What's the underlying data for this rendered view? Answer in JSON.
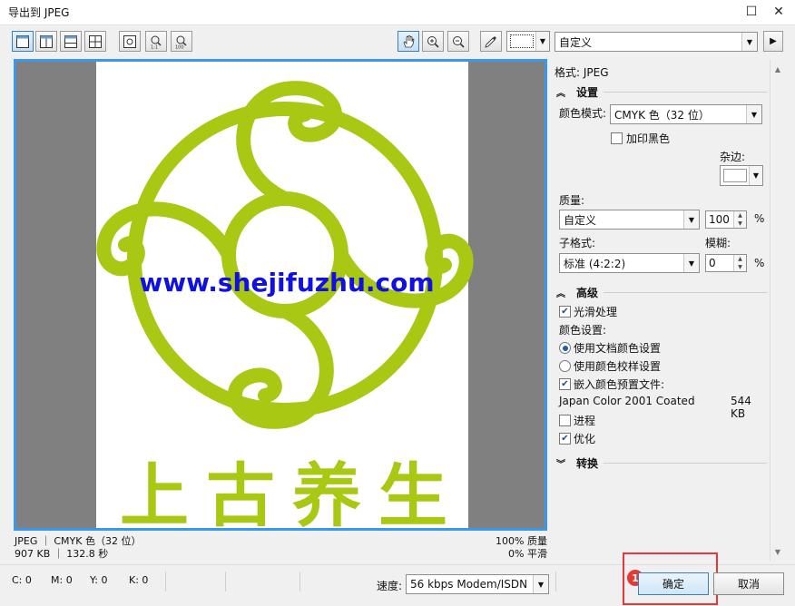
{
  "window": {
    "title": "导出到 JPEG"
  },
  "toolbar": {
    "right_combo": "自定义"
  },
  "preview": {
    "url_text": "www.shejifuzhu.com",
    "logo_chars": [
      "上",
      "古",
      "养",
      "生"
    ],
    "logo_color": "#a8c813",
    "url_color": "#1010e0"
  },
  "info": {
    "line1_left": "JPEG ｜ CMYK 色（32 位）",
    "line2_left": "907 KB ｜ 132.8 秒",
    "line1_right": "100% 质量",
    "line2_right": "0% 平滑"
  },
  "side": {
    "format": "格式: JPEG",
    "settings": {
      "header": "设置",
      "color_mode_label": "颜色模式:",
      "color_mode_value": "CMYK 色（32 位）",
      "overprint_black": "加印黑色",
      "matte_label": "杂边:",
      "quality_label": "质量:",
      "quality_value": "自定义",
      "quality_num": "100",
      "pct1": "%",
      "subformat_label": "子格式:",
      "blur_label": "模糊:",
      "subformat_value": "标准 (4:2:2)",
      "blur_num": "0",
      "pct2": "%"
    },
    "advanced": {
      "header": "高级",
      "antialias": "光滑处理",
      "color_settings_label": "颜色设置:",
      "use_doc_color": "使用文档颜色设置",
      "use_proof": "使用颜色校样设置",
      "embed_profile": "嵌入颜色预置文件:",
      "profile_name": "Japan Color 2001 Coated",
      "profile_size": "544 KB",
      "progressive": "进程",
      "optimize": "优化"
    },
    "transform": {
      "header": "转换"
    }
  },
  "status": {
    "c": "C: 0",
    "m": "M: 0",
    "y": "Y: 0",
    "k": "K: 0",
    "speed_label": "速度:",
    "speed_value": "56 kbps Modem/ISDN"
  },
  "buttons": {
    "ok": "确定",
    "cancel": "取消",
    "badge": "1"
  }
}
